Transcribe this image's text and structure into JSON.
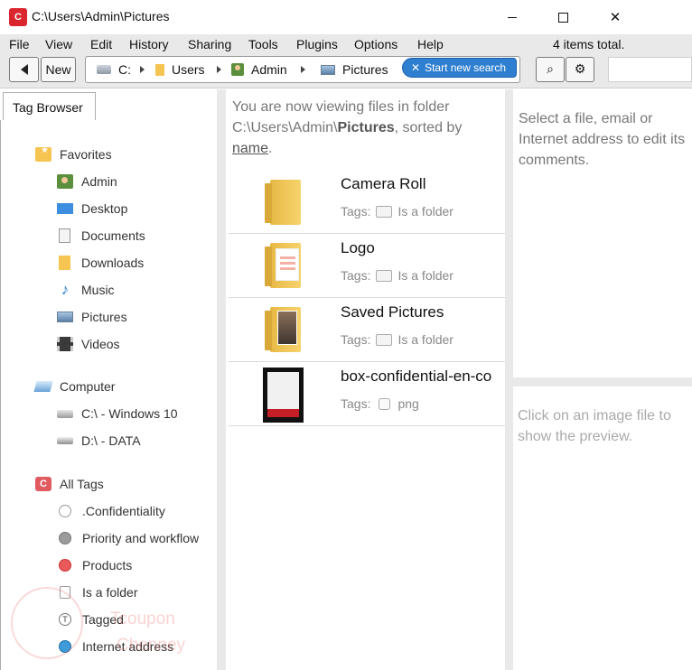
{
  "window": {
    "title": "C:\\Users\\Admin\\Pictures",
    "app_icon_letter": "C",
    "minimize_label": "",
    "close_glyph": "✕"
  },
  "menu": {
    "items": [
      "File",
      "View",
      "Edit",
      "History",
      "Sharing",
      "Tools",
      "Plugins",
      "Options",
      "Help"
    ],
    "items_total": "4 items total."
  },
  "toolbar": {
    "new_label": "New",
    "breadcrumb": [
      {
        "label": "C:",
        "icon": "drive-icon"
      },
      {
        "label": "Users",
        "icon": "folder-icon"
      },
      {
        "label": "Admin",
        "icon": "user-icon"
      },
      {
        "label": "Pictures",
        "icon": "pictures-icon"
      }
    ],
    "search_pill_label": "Start new search",
    "search_pill_x": "✕",
    "find_icon_glyph": "⌕",
    "settings_icon_glyph": "⚙"
  },
  "tag_browser": {
    "tab_label": "Tag Browser",
    "favorites": {
      "label": "Favorites",
      "items": [
        "Admin",
        "Desktop",
        "Documents",
        "Downloads",
        "Music",
        "Pictures",
        "Videos"
      ]
    },
    "computer": {
      "label": "Computer",
      "items": [
        "C:\\ - Windows 10",
        "D:\\ - DATA"
      ]
    },
    "all_tags": {
      "label": "All Tags",
      "items": [
        ".Confidentiality",
        "Priority and workflow",
        "Products",
        "Is a folder",
        "Tagged",
        "Internet address"
      ]
    },
    "music_glyph": "♪",
    "tagged_glyph": "T",
    "watermark_line1": "Tcoupon",
    "watermark_line2": "Chenney"
  },
  "file_list": {
    "info_prefix": "You are now viewing files in folder C:\\Users\\Admin\\",
    "info_folder": "Pictures",
    "info_middle": ", sorted by",
    "info_sort": "name",
    "info_suffix": ".",
    "tags_label": "Tags:",
    "files": [
      {
        "name": "Camera Roll",
        "tag": "Is a folder",
        "thumb": "folder"
      },
      {
        "name": "Logo",
        "tag": "Is a folder",
        "thumb": "folder-logo"
      },
      {
        "name": "Saved Pictures",
        "tag": "Is a folder",
        "thumb": "folder-saved"
      },
      {
        "name": "box-confidential-en-co",
        "tag": "png",
        "thumb": "image"
      }
    ]
  },
  "comments_pane": {
    "text": "Select a file, email or Internet address to edit its comments."
  },
  "preview_pane": {
    "text": "Click on an image file to show the preview."
  },
  "colors": {
    "accent": "#2f7fd1",
    "brand_red": "#d9262f",
    "chrome_bg": "#e9e9e9"
  }
}
